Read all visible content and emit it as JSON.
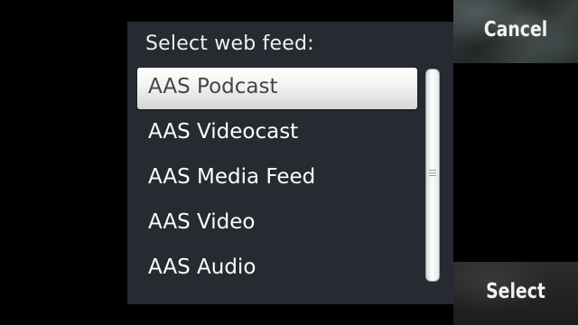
{
  "dialog": {
    "title": "Select web feed:",
    "items": [
      {
        "label": "AAS Podcast",
        "selected": true
      },
      {
        "label": "AAS Videocast",
        "selected": false
      },
      {
        "label": "AAS Media Feed",
        "selected": false
      },
      {
        "label": "AAS Video",
        "selected": false
      },
      {
        "label": "AAS Audio",
        "selected": false
      }
    ]
  },
  "softkeys": {
    "cancel_label": "Cancel",
    "select_label": "Select"
  },
  "colors": {
    "screen_background": "#000000",
    "dialog_background": "#252b30",
    "item_text": "#ffffff",
    "selected_item_text": "#454545",
    "selected_item_background": "#f2f2f2"
  }
}
